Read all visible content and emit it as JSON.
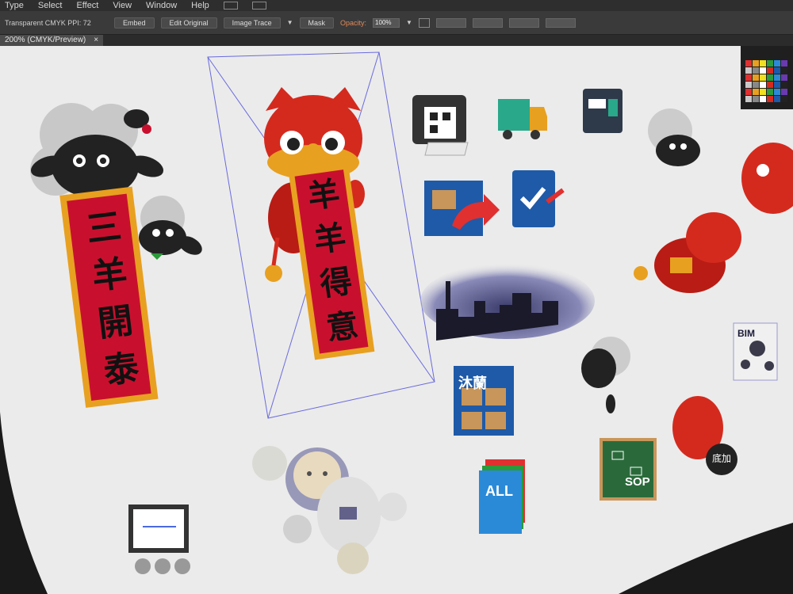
{
  "menu": [
    "Type",
    "Select",
    "Effect",
    "View",
    "Window",
    "Help"
  ],
  "control_bar": {
    "document_info": "Transparent CMYK  PPI: 72",
    "embed_label": "Embed",
    "edit_original_label": "Edit Original",
    "image_trace_label": "Image Trace",
    "mask_label": "Mask",
    "opacity_label": "Opacity:",
    "opacity_value": "100%"
  },
  "tab": {
    "title": "200% (CMYK/Preview)",
    "close": "×"
  },
  "artwork": {
    "couplet_left": [
      "三",
      "羊",
      "開",
      "泰"
    ],
    "couplet_right": [
      "羊",
      "羊",
      "得",
      "意"
    ],
    "shelf_label": "沐蘭",
    "sop_label": "SOP",
    "all_label": "ALL",
    "bim_label": "BIM",
    "badge_label": "底加"
  },
  "colors": {
    "canvas": "#ebebeb",
    "couplet_red": "#c8102e",
    "couplet_gold": "#e8a020",
    "lion_red": "#d42a1e",
    "ui_dark": "#2e2e2e",
    "selection": "#6a6adf"
  }
}
